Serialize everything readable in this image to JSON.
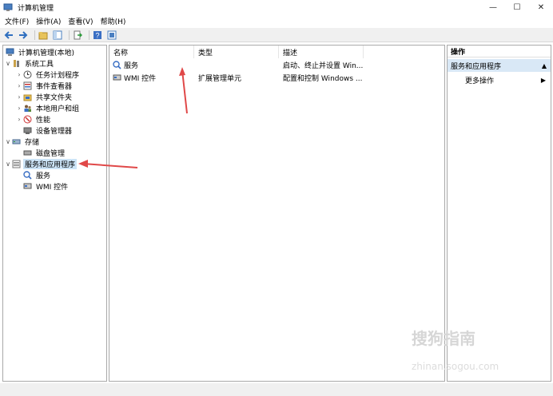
{
  "window": {
    "title": "计算机管理",
    "controls": [
      "—",
      "☐",
      "✕"
    ]
  },
  "menu": [
    "文件(F)",
    "操作(A)",
    "查看(V)",
    "帮助(H)"
  ],
  "tree": [
    {
      "label": "计算机管理(本地)",
      "expander": "",
      "icon": "computer-management-icon"
    },
    {
      "label": "系统工具",
      "expander": "∨",
      "icon": "tools-icon"
    },
    {
      "label": "任务计划程序",
      "expander": "›",
      "icon": "clock-icon"
    },
    {
      "label": "事件查看器",
      "expander": "›",
      "icon": "event-viewer-icon"
    },
    {
      "label": "共享文件夹",
      "expander": "›",
      "icon": "shared-folder-icon"
    },
    {
      "label": "本地用户和组",
      "expander": "›",
      "icon": "users-icon"
    },
    {
      "label": "性能",
      "expander": "›",
      "icon": "performance-icon"
    },
    {
      "label": "设备管理器",
      "expander": "",
      "icon": "device-manager-icon"
    },
    {
      "label": "存储",
      "expander": "∨",
      "icon": "storage-icon"
    },
    {
      "label": "磁盘管理",
      "expander": "",
      "icon": "disk-icon"
    },
    {
      "label": "服务和应用程序",
      "expander": "∨",
      "icon": "services-apps-icon",
      "selected": true
    },
    {
      "label": "服务",
      "expander": "",
      "icon": "services-icon"
    },
    {
      "label": "WMI 控件",
      "expander": "",
      "icon": "wmi-icon"
    }
  ],
  "list": {
    "columns": [
      "名称",
      "类型",
      "描述"
    ],
    "rows": [
      {
        "name": "服务",
        "type": "",
        "desc": "启动、终止并设置 Win...",
        "icon": "services-icon"
      },
      {
        "name": "WMI 控件",
        "type": "扩展管理单元",
        "desc": "配置和控制 Windows ...",
        "icon": "wmi-icon"
      }
    ]
  },
  "actions": {
    "header": "操作",
    "section": "服务和应用程序",
    "section_caret": "▲",
    "item": "更多操作",
    "item_arrow": "▶"
  },
  "watermark": {
    "main": "搜狗指南",
    "sub": "zhinan.sogou.com"
  },
  "colors": {
    "selection": "#cce4f7",
    "annotation_arrow": "#e04848",
    "actions_section": "#d9e8f6"
  }
}
